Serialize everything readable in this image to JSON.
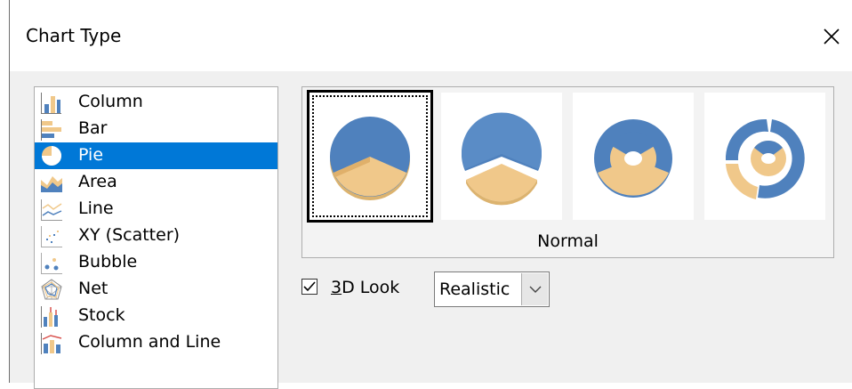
{
  "dialog": {
    "title": "Chart Type"
  },
  "chart_types": [
    {
      "label": "Column",
      "icon": "column-chart-icon"
    },
    {
      "label": "Bar",
      "icon": "bar-chart-icon"
    },
    {
      "label": "Pie",
      "icon": "pie-chart-icon",
      "selected": true
    },
    {
      "label": "Area",
      "icon": "area-chart-icon"
    },
    {
      "label": "Line",
      "icon": "line-chart-icon"
    },
    {
      "label": "XY (Scatter)",
      "icon": "scatter-chart-icon"
    },
    {
      "label": "Bubble",
      "icon": "bubble-chart-icon"
    },
    {
      "label": "Net",
      "icon": "net-chart-icon"
    },
    {
      "label": "Stock",
      "icon": "stock-chart-icon"
    },
    {
      "label": "Column and Line",
      "icon": "column-and-line-chart-icon"
    }
  ],
  "variants": {
    "selected_name": "Normal",
    "items": [
      "normal-pie",
      "exploded-pie",
      "donut",
      "exploded-donut"
    ]
  },
  "options": {
    "look3d_label_accel": "3",
    "look3d_label_rest": "D Look",
    "look3d_checked": true,
    "look3d_style": "Realistic"
  },
  "colors": {
    "selection": "#0078d7",
    "pie_blue": "#4f81bd",
    "pie_gold": "#f0c88a"
  }
}
